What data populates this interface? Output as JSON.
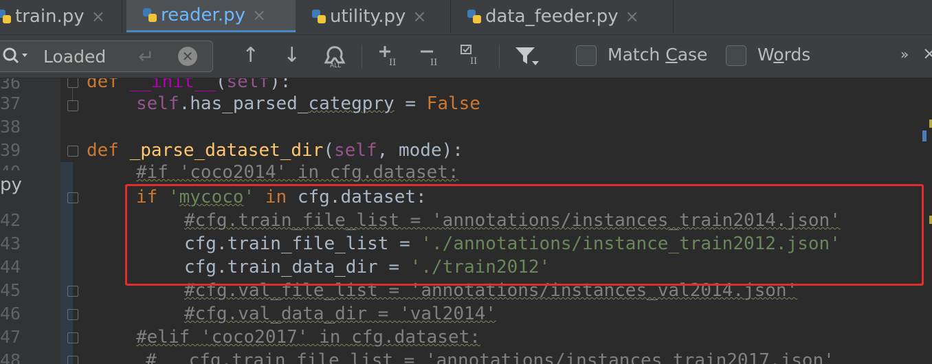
{
  "tabs": [
    {
      "label": "train.py",
      "active": false
    },
    {
      "label": "reader.py",
      "active": true
    },
    {
      "label": "utility.py",
      "active": false
    },
    {
      "label": "data_feeder.py",
      "active": false
    }
  ],
  "search": {
    "value": "Loaded",
    "match_case_label_pre": "Match ",
    "match_case_label_u": "C",
    "match_case_label_post": "ase",
    "words_label_pre": "W",
    "words_label_u": "o",
    "words_label_post": "rds",
    "overflow": "»"
  },
  "editor": {
    "side_label": "py",
    "line_numbers": [
      "36",
      "37",
      "38",
      "39",
      "40",
      "",
      "42",
      "43",
      "44",
      "45",
      "46",
      "47",
      "48"
    ],
    "lines": {
      "l36": {
        "kw": "def ",
        "name": "__init__",
        "rest1": "(",
        "self": "self",
        "rest2": "):"
      },
      "l37": {
        "self": "self",
        "attr": ".has_parsed_",
        "squig": "categpry",
        "eq": " = ",
        "val": "False"
      },
      "l39": {
        "kw": "def ",
        "fn": "_parse_dataset_dir",
        "p1": "(",
        "self": "self",
        "p2": ", mode):"
      },
      "l40": {
        "cmt": "#if 'coco2014' in cfg.dataset:"
      },
      "l41": {
        "kw1": "if ",
        "q1": "'",
        "str": "mycoco",
        "q2": "'",
        "kw2": " in ",
        "rest": "cfg.dataset:"
      },
      "l42": {
        "cmt": "#cfg.train_file_list = 'annotations/instances_train2014.json'"
      },
      "l43": {
        "pre": "cfg.train_file_list = ",
        "str": "'./annotations/instance_train2012.json'"
      },
      "l44": {
        "pre": "cfg.train_data_dir = ",
        "str": "'./train2012'"
      },
      "l45": {
        "cmt": "#cfg.val_file_list = 'annotations/instances_val2014.json'"
      },
      "l46": {
        "cmt": "#cfg.val_data_dir = 'val2014'"
      },
      "l47": {
        "cmt": "#elif 'coco2017' in cfg.dataset:"
      },
      "l48": {
        "cmt": "#   cfg.train_file_list = 'annotations/instances_train2017.json'"
      }
    }
  },
  "colors": {
    "highlight_box": "#e22d2d",
    "active_tab_text": "#6cb6ff",
    "keyword": "#cc7832",
    "string": "#6a8759",
    "comment": "#808080"
  }
}
